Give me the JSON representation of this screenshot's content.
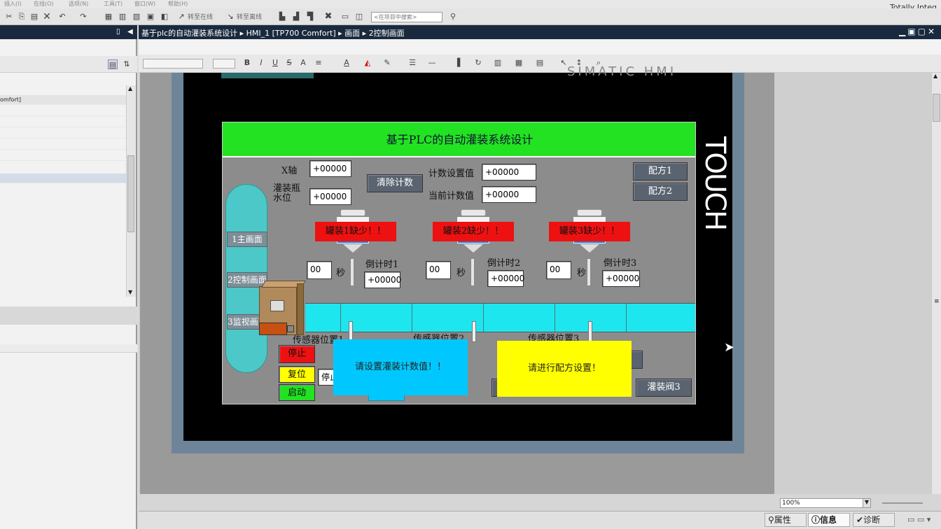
{
  "menubar": {
    "items": [
      "插入(I)",
      "在线(O)",
      "选项(N)",
      "工具(T)",
      "窗口(W)",
      "帮助(H)"
    ],
    "brand": "Totally Integ"
  },
  "toolbar": {
    "go_online": "转至在线",
    "go_offline": "转至离线",
    "search_placeholder": "<在项目中搜索>"
  },
  "left_pane": {
    "tree_item": "omfort]"
  },
  "editor": {
    "breadcrumb": [
      "基于plc的自动灌装系统设计",
      "HMI_1 [TP700 Comfort]",
      "画面",
      "2控制画面"
    ],
    "separator": "▸"
  },
  "device": {
    "touch_label": "TOUCH",
    "siemens_partial": "SIMATIC HMI"
  },
  "hmi": {
    "title": "基于PLC的自动灌装系统设计",
    "x_axis_label": "X轴",
    "x_axis_value": "+00000",
    "fill_bottle_label": "灌装瓶\n水位",
    "fill_bottle_value": "+00000",
    "clear_count_button": "清除计数",
    "count_setpoint_label": "计数设置值",
    "count_setpoint_value": "+00000",
    "current_count_label": "当前计数值",
    "current_count_value": "+00000",
    "recipe1_button": "配方1",
    "recipe2_button": "配方2",
    "nav_main": "1主画面",
    "nav_control": "2控制画面",
    "nav_monitor": "3监视画面",
    "tanks": [
      {
        "alarm": "罐装1缺少！！",
        "seconds_value": "00",
        "seconds_unit": "秒",
        "countdown_label": "倒计时1",
        "countdown_value": "+00000"
      },
      {
        "alarm": "罐装2缺少！！",
        "seconds_value": "00",
        "seconds_unit": "秒",
        "countdown_label": "倒计时2",
        "countdown_value": "+00000"
      },
      {
        "alarm": "罐装3缺少！！",
        "seconds_value": "00",
        "seconds_unit": "秒",
        "countdown_label": "倒计时3",
        "countdown_value": "+00000"
      }
    ],
    "sensors": [
      "传感器位置1",
      "传感器位置2",
      "传感器位置3"
    ],
    "stop_button": "停止",
    "reset_button": "复位",
    "start_button": "启动",
    "status_field": "停止",
    "popup_count": "请设置灌装计数值！！",
    "popup_recipe": "请进行配方设置！",
    "valve3_button": "灌装阀3"
  },
  "statusbar": {
    "zoom": "100%",
    "tab_properties": "属性",
    "tab_info": "信息",
    "tab_diagnostics": "诊断"
  },
  "colors": {
    "title_green": "#22e222",
    "alarm_red": "#ee1111",
    "conveyor_cyan": "#1ee6ee",
    "popup_blue": "#00c8ff",
    "popup_yellow": "#ffff00",
    "header_dark": "#1a2a3e"
  }
}
